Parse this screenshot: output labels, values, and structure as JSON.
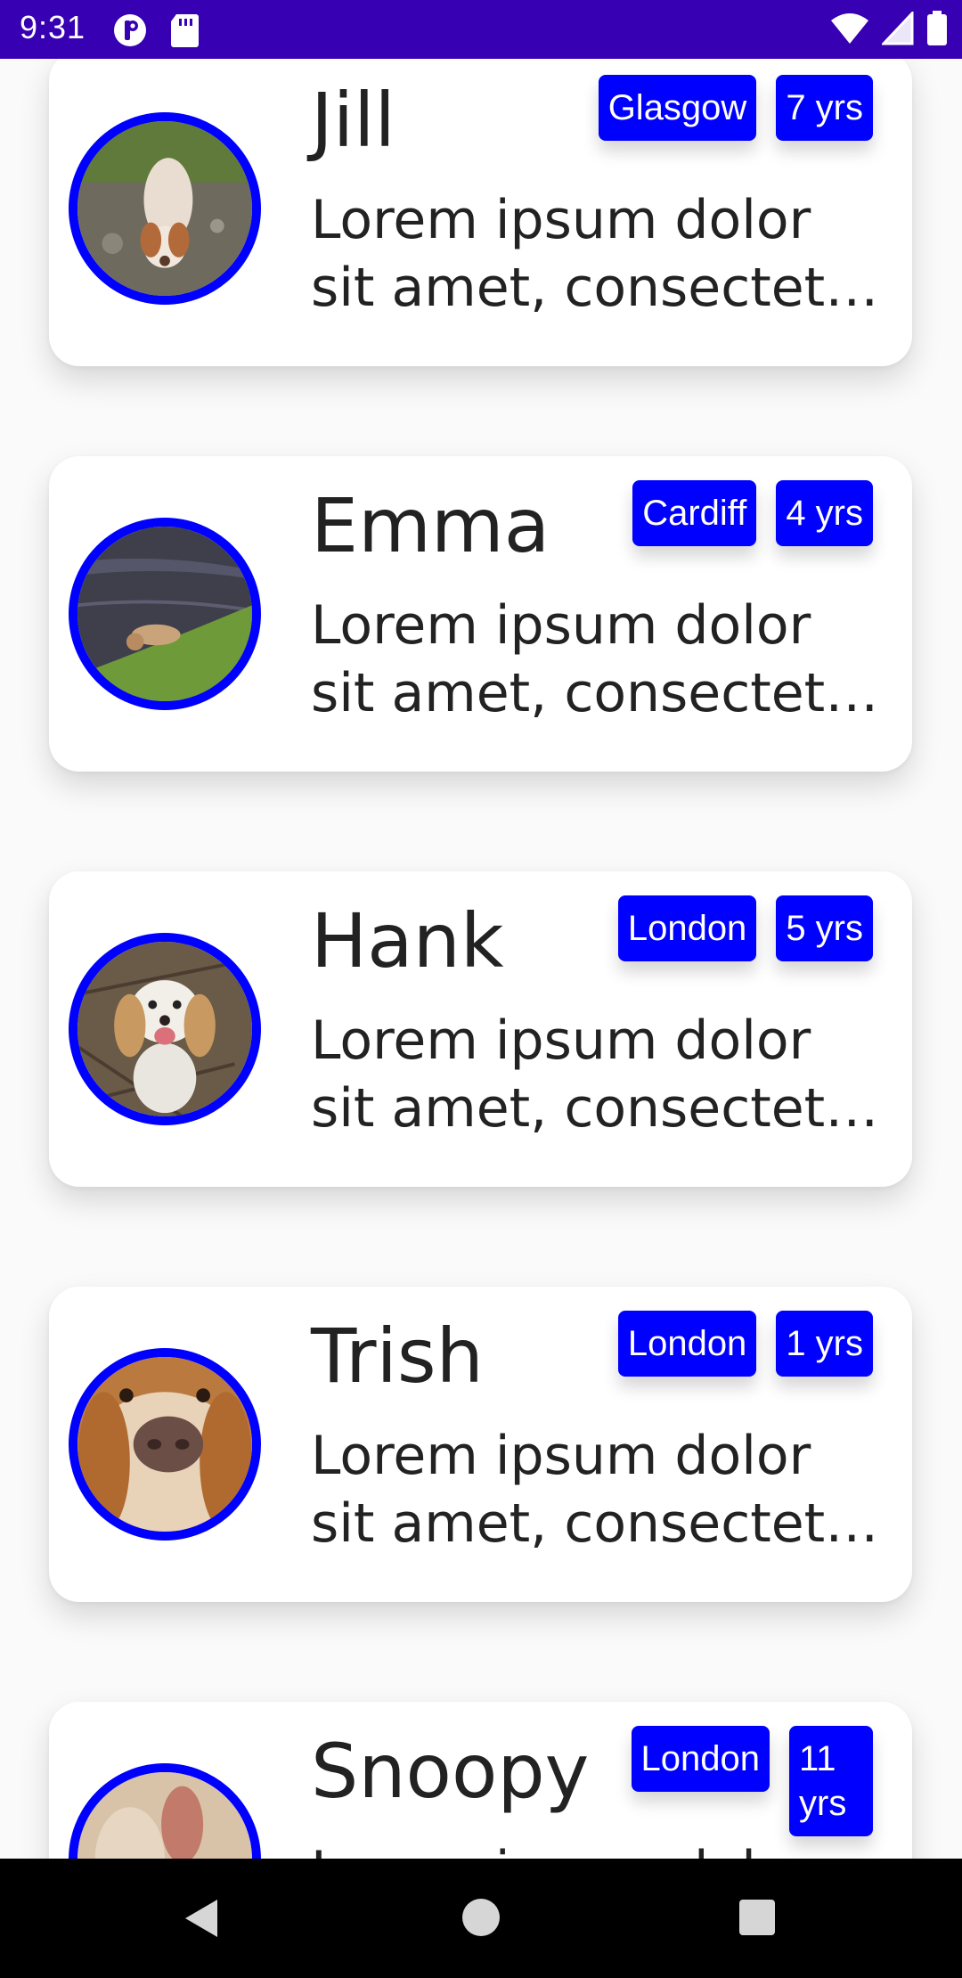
{
  "status_bar": {
    "time": "9:31",
    "icons_left": [
      "pinterest-like-icon",
      "sd-card-icon"
    ],
    "icons_right": [
      "wifi-icon",
      "signal-icon",
      "battery-icon"
    ],
    "background": "#3700b3"
  },
  "accent_color": "#0000ff",
  "cards": [
    {
      "name": "Jill",
      "location": "Glasgow",
      "age": "7 yrs",
      "description": "Lorem ipsum dolor sit amet, consectetur adipiscing elit"
    },
    {
      "name": "Emma",
      "location": "Cardiff",
      "age": "4 yrs",
      "description": "Lorem ipsum dolor sit amet, consectetur adipiscing elit"
    },
    {
      "name": "Hank",
      "location": "London",
      "age": "5 yrs",
      "description": "Lorem ipsum dolor sit amet, consectetur adipiscing elit"
    },
    {
      "name": "Trish",
      "location": "London",
      "age": "1 yrs",
      "description": "Lorem ipsum dolor sit amet, consectetur adipiscing elit"
    },
    {
      "name": "Snoopy",
      "location": "London",
      "age": "11 yrs",
      "description": "Lorem ipsum dolor sit amet, consectetur adipiscing elit"
    }
  ],
  "nav_bar": {
    "buttons": [
      "back-icon",
      "home-icon",
      "recents-icon"
    ]
  }
}
